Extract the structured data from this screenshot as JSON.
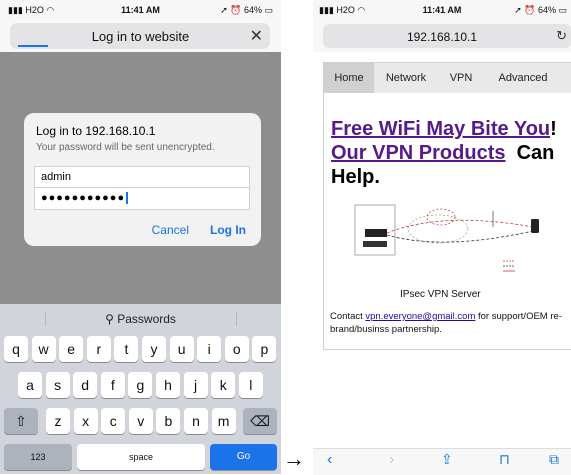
{
  "left_phone": {
    "status": {
      "carrier": "H2O",
      "time": "11:41 AM",
      "battery": "64%"
    },
    "nav": {
      "title": "Log in to website",
      "close": "✕"
    },
    "dialog": {
      "title": "Log in to 192.168.10.1",
      "subtitle": "Your password will be sent unencrypted.",
      "username": "admin",
      "password": "●●●●●●●●●●●",
      "cancel": "Cancel",
      "login": "Log In"
    },
    "keyboard": {
      "suggestion": "Passwords",
      "row1": [
        "q",
        "w",
        "e",
        "r",
        "t",
        "y",
        "u",
        "i",
        "o",
        "p"
      ],
      "row2": [
        "a",
        "s",
        "d",
        "f",
        "g",
        "h",
        "j",
        "k",
        "l"
      ],
      "row3": [
        "z",
        "x",
        "c",
        "v",
        "b",
        "n",
        "m"
      ],
      "numbers": "123",
      "space": "space",
      "go": "Go"
    }
  },
  "arrow": "→",
  "right_phone": {
    "status": {
      "carrier": "H2O",
      "time": "11:41 AM",
      "battery": "64%"
    },
    "url": "192.168.10.1",
    "tabs": [
      "Home",
      "Network",
      "VPN",
      "Advanced"
    ],
    "headline": {
      "link1": "Free WiFi May Bite You",
      "excl": "!",
      "link2": "Our VPN Products",
      "rest1": "Can",
      "rest2": "Help."
    },
    "caption": "IPsec VPN Server",
    "contact": {
      "prefix": "Contact ",
      "email": "vpn.everyone@gmail.com",
      "suffix": " for support/OEM re-brand/businss partnership."
    },
    "colors": {
      "accent": "#1a73e8",
      "link": "#551a8b"
    }
  }
}
